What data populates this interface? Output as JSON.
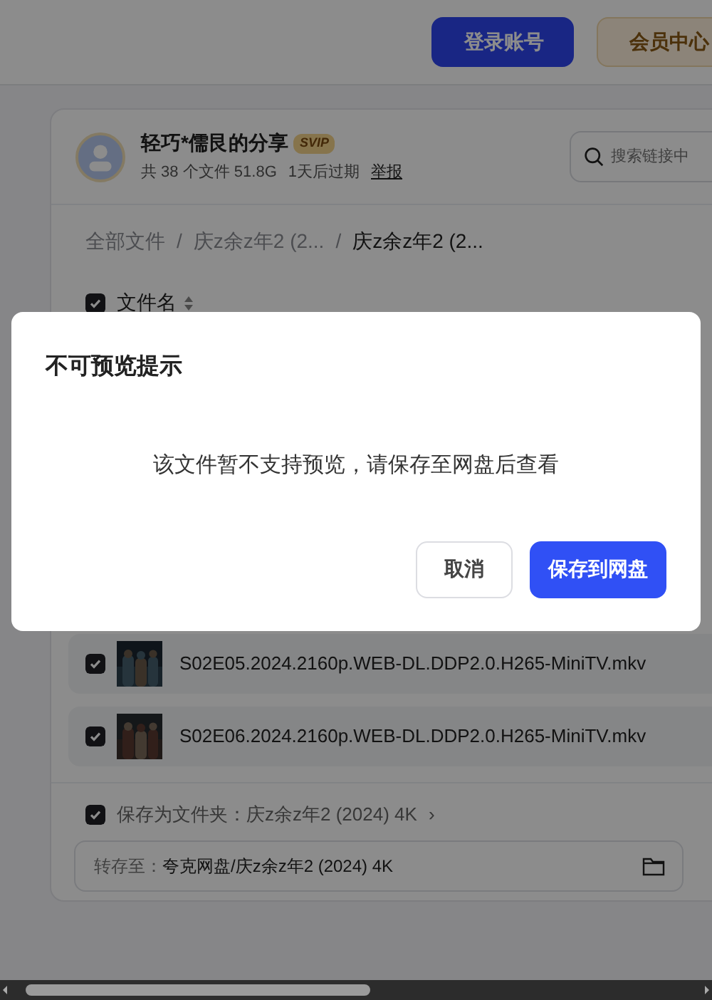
{
  "header": {
    "buttons": [
      {
        "label": "登录账号",
        "kind": "primary"
      },
      {
        "label": "会员中心",
        "kind": "vip"
      }
    ]
  },
  "share": {
    "title": "轻巧*儒艮的分享",
    "badge": "SVIP",
    "meta": "共 38 个文件 51.8G",
    "expiry": "1天后过期",
    "report": "举报",
    "search": {
      "placeholder": "搜索链接中"
    }
  },
  "breadcrumb": {
    "separator": "/",
    "items": [
      {
        "label": "全部文件",
        "current": false
      },
      {
        "label": "庆z余z年2 (2...",
        "current": false
      },
      {
        "label": "庆z余z年2 (2...",
        "current": true
      }
    ]
  },
  "file_list": {
    "header": {
      "label": "文件名",
      "checked": true
    },
    "rows": [
      {
        "name": "S02E05.2024.2160p.WEB-DL.DDP2.0.H265-MiniTV.mkv",
        "checked": true
      },
      {
        "name": "S02E06.2024.2160p.WEB-DL.DDP2.0.H265-MiniTV.mkv",
        "checked": true
      }
    ]
  },
  "save_as_folder": {
    "checked": true,
    "label": "保存为文件夹：庆z余z年2 (2024) 4K",
    "chevron": "›"
  },
  "save_to": {
    "label": "转存至：",
    "path": "夸克网盘/庆z余z年2 (2024) 4K"
  },
  "dialog": {
    "title": "不可预览提示",
    "message": "该文件暂不支持预览，请保存至网盘后查看",
    "buttons": [
      {
        "label": "取消",
        "kind": "secondary"
      },
      {
        "label": "保存到网盘",
        "kind": "primary"
      }
    ]
  }
}
